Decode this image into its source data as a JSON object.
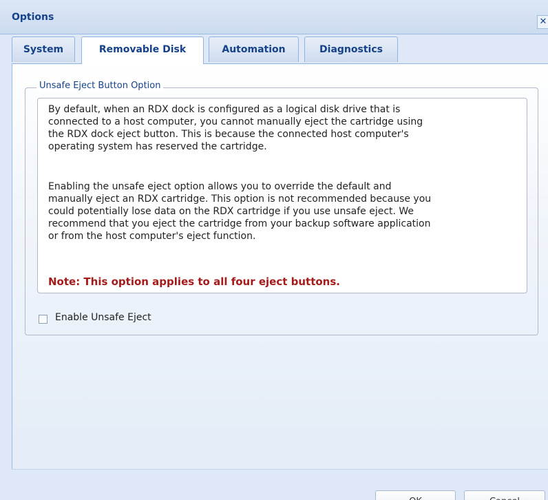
{
  "window": {
    "title": "Options",
    "close_glyph": "✕"
  },
  "tabs": [
    {
      "label": "System",
      "active": false
    },
    {
      "label": "Removable Disk",
      "active": true
    },
    {
      "label": "Automation",
      "active": false
    },
    {
      "label": "Diagnostics",
      "active": false
    }
  ],
  "section": {
    "legend": "Unsafe Eject Button Option",
    "paragraph_1_lines": [
      "By default, when an RDX dock is configured as a logical disk drive that is",
      "connected to a host computer, you cannot manually eject the cartridge using",
      "the RDX dock eject button. This is because the connected host computer's",
      "operating system has reserved the cartridge."
    ],
    "paragraph_2_lines": [
      "Enabling the unsafe eject option allows you to override the default and",
      "manually eject an RDX cartridge. This option is not recommended because you",
      "could potentially lose data on the RDX cartridge if you use unsafe eject. We",
      "recommend that you eject the cartridge from your backup software application",
      "or from the host computer's eject function."
    ],
    "note": "Note: This option applies to all four eject buttons.",
    "checkbox": {
      "label": "Enable Unsafe Eject",
      "checked": false
    }
  },
  "buttons": {
    "ok_label": "OK",
    "cancel_label": "Cancel"
  },
  "colors": {
    "title_text": "#15428b",
    "note_text": "#a51a1a",
    "panel_background": "#dfe8f6"
  }
}
